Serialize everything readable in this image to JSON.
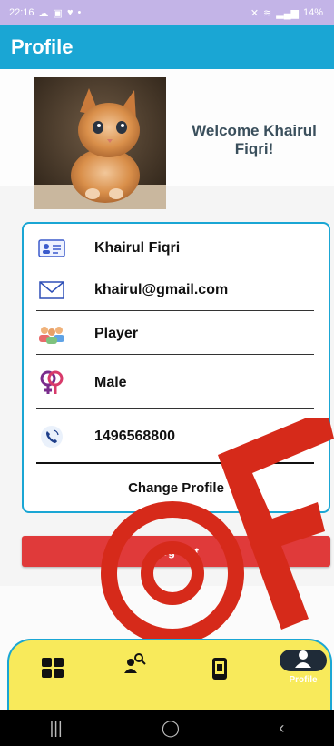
{
  "status_bar": {
    "time": "22:16",
    "battery": "14%"
  },
  "app_bar": {
    "title": "Profile"
  },
  "profile": {
    "welcome": "Welcome Khairul Fiqri!",
    "name": "Khairul Fiqri",
    "email": "khairul@gmail.com",
    "role": "Player",
    "gender": "Male",
    "phone": "1496568800",
    "change_label": "Change Profile"
  },
  "actions": {
    "logout_label": "Log Out"
  },
  "bottom_nav": {
    "items": [
      {
        "icon": "grid-icon"
      },
      {
        "icon": "user-search-icon"
      },
      {
        "icon": "phone-device-icon"
      },
      {
        "icon": "person-icon",
        "label": "Profile",
        "active": true
      }
    ]
  },
  "colors": {
    "status_bar": "#c3b4e7",
    "app_bar": "#1aa6d4",
    "logout": "#e03a3a",
    "nav": "#f8ea5b",
    "accent": "#1aa6d4"
  }
}
